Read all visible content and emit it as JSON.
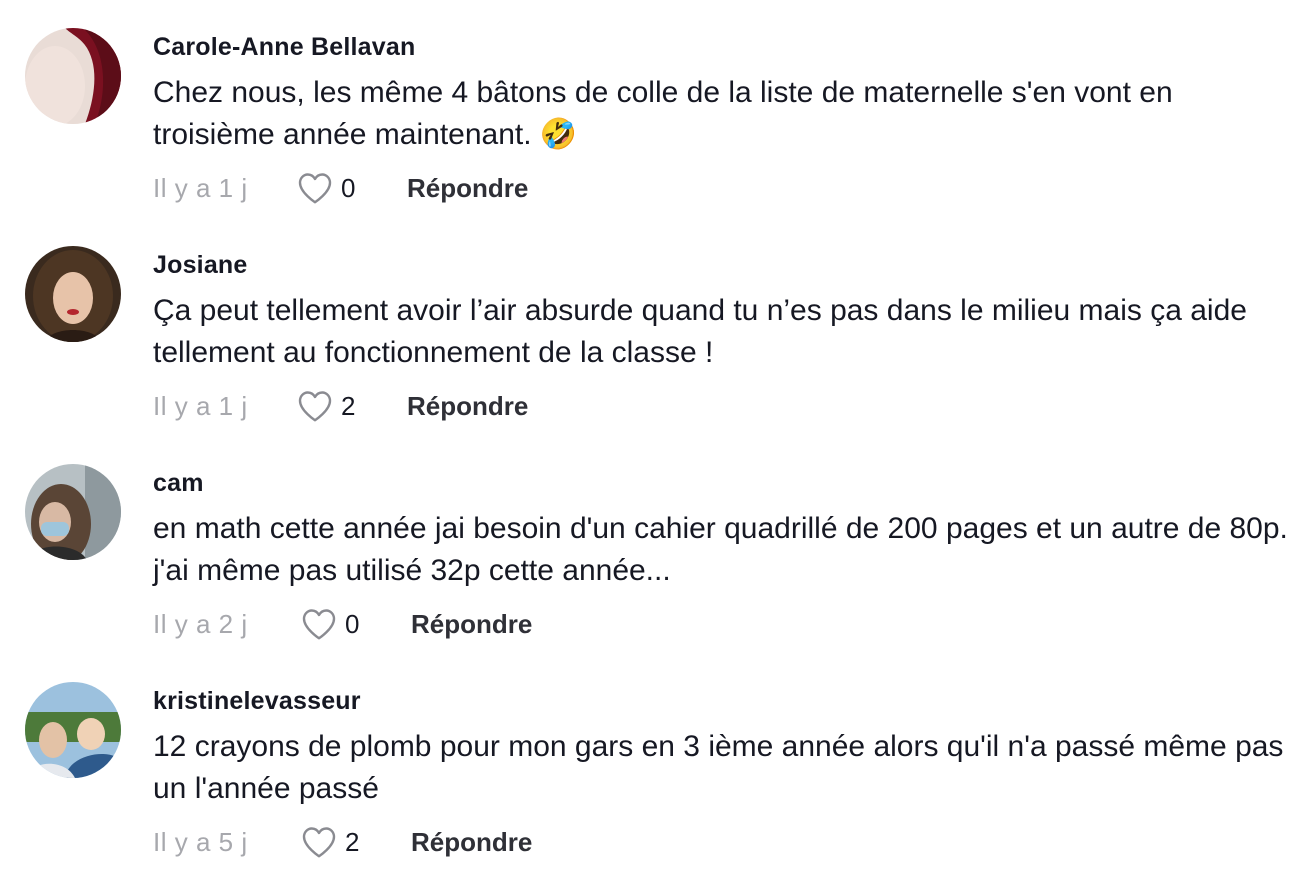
{
  "comments": [
    {
      "author": "Carole-Anne Bellavan",
      "text": "Chez nous, les même 4 bâtons de colle de la liste de maternelle s'en vont en troisième année maintenant.",
      "emoji": "🤣",
      "time": "Il y a 1 j",
      "likes": "0",
      "reply_label": "Répondre",
      "avatar_colors": [
        "#7a1020",
        "#e8d6d0"
      ]
    },
    {
      "author": "Josiane",
      "text": "Ça peut tellement avoir l’air absurde quand tu n’es pas dans le milieu mais ça aide tellement au fonctionnement de la classe !",
      "emoji": "",
      "time": "Il y a 1 j",
      "likes": "2",
      "reply_label": "Répondre",
      "avatar_colors": [
        "#4a3220",
        "#e6c2a8"
      ]
    },
    {
      "author": "cam",
      "text": "en math cette année jai besoin d'un cahier quadrillé de 200 pages et un autre de 80p. j'ai même pas utilisé 32p cette année...",
      "emoji": "",
      "time": "Il y a 2 j",
      "likes": "0",
      "reply_label": "Répondre",
      "avatar_colors": [
        "#5a4a3e",
        "#a9b6bd"
      ]
    },
    {
      "author": "kristinelevasseur",
      "text": "12 crayons de plomb pour mon gars en 3 ième année alors qu'il n'a passé même pas un l'année passé",
      "emoji": "",
      "time": "Il y a 5 j",
      "likes": "2",
      "reply_label": "Répondre",
      "avatar_colors": [
        "#2e5a8c",
        "#8fb6d8"
      ]
    }
  ],
  "icons": {
    "like": "heart-outline-icon"
  }
}
